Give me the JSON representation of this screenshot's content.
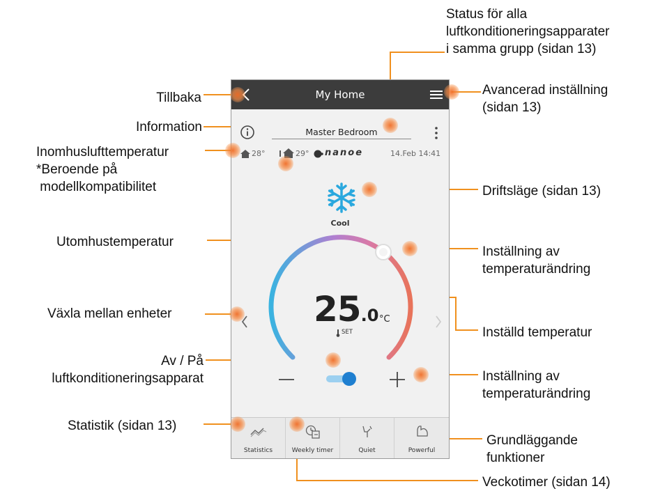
{
  "app": {
    "title": "My Home",
    "room": "Master Bedroom",
    "indoor_temp": "28°",
    "outdoor_temp": "29°",
    "brand": "nanoe",
    "datetime": "14.Feb 14:41",
    "mode": "Cool",
    "set_temp_int": "25",
    "set_temp_dec": ".0",
    "temp_unit": "°C",
    "set_label": "SET",
    "minus": "—",
    "plus": "+",
    "power_on": true,
    "tabs": [
      {
        "label": "Statistics",
        "icon": "statistics-icon"
      },
      {
        "label": "Weekly timer",
        "icon": "weekly-timer-icon"
      },
      {
        "label": "Quiet",
        "icon": "quiet-icon"
      },
      {
        "label": "Powerful",
        "icon": "powerful-icon"
      }
    ]
  },
  "annotations": {
    "back": "Tillbaka",
    "information": "Information",
    "indoor": "Inomhuslufttemperatur\n*Beroende på\n modellkompatibilitet",
    "outdoor": "Utomhustemperatur",
    "switch_units": "Växla mellan enheter",
    "power": "Av / På\nluftkonditioneringsapparat",
    "statistics": "Statistik (sidan 13)",
    "status_all": "Status för alla\nluftkonditioneringsapparater\ni samma grupp (sidan 13)",
    "advanced": "Avancerad inställning\n(sidan 13)",
    "mode": "Driftsläge (sidan 13)",
    "temp_change_1": "Inställning av\ntemperaturändring",
    "set_temp": "Inställd temperatur",
    "temp_change_2": "Inställning av\ntemperaturändring",
    "basic": "Grundläggande\nfunktioner",
    "weekly": "Veckotimer (sidan 14)"
  },
  "colors": {
    "header": "#3c3c3c",
    "accent_blue": "#2f9be0",
    "callout_orange": "#f0901e",
    "warm_arc": "#e8735a"
  }
}
